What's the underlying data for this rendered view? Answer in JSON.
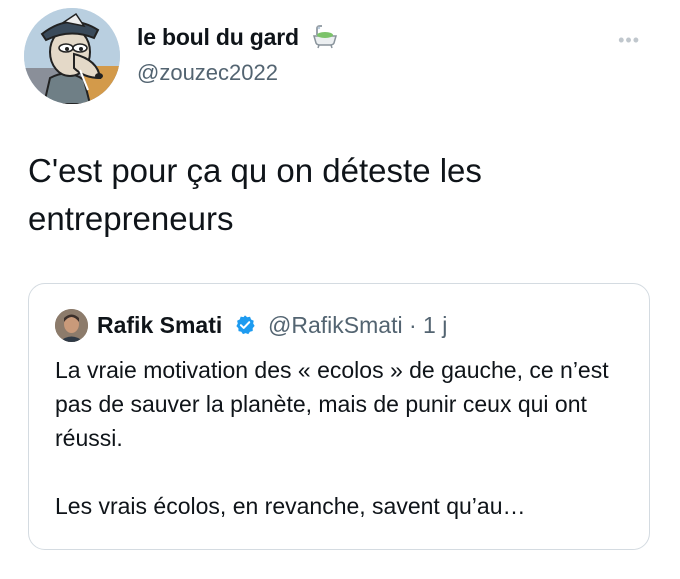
{
  "tweet": {
    "display_name": "le boul du gard",
    "handle": "@zouzec2022",
    "name_emoji_icon": "bathtub-icon",
    "more_label": "•••",
    "text": "C'est pour ça qu on déteste les entrepreneurs"
  },
  "quoted_tweet": {
    "name": "Rafik Smati",
    "verified_icon": "verified-badge-icon",
    "handle": "@RafikSmati",
    "separator": "·",
    "time": "1 j",
    "paragraph_1": "La vraie motivation des « ecolos » de gauche, ce n’est pas de sauver la planète, mais de punir ceux qui ont réussi.",
    "paragraph_2": "Les vrais écolos, en revanche, savent qu’au…"
  },
  "colors": {
    "text": "#0f1419",
    "secondary": "#536471",
    "border": "#d4dbe1",
    "verified": "#1d9bf0"
  }
}
